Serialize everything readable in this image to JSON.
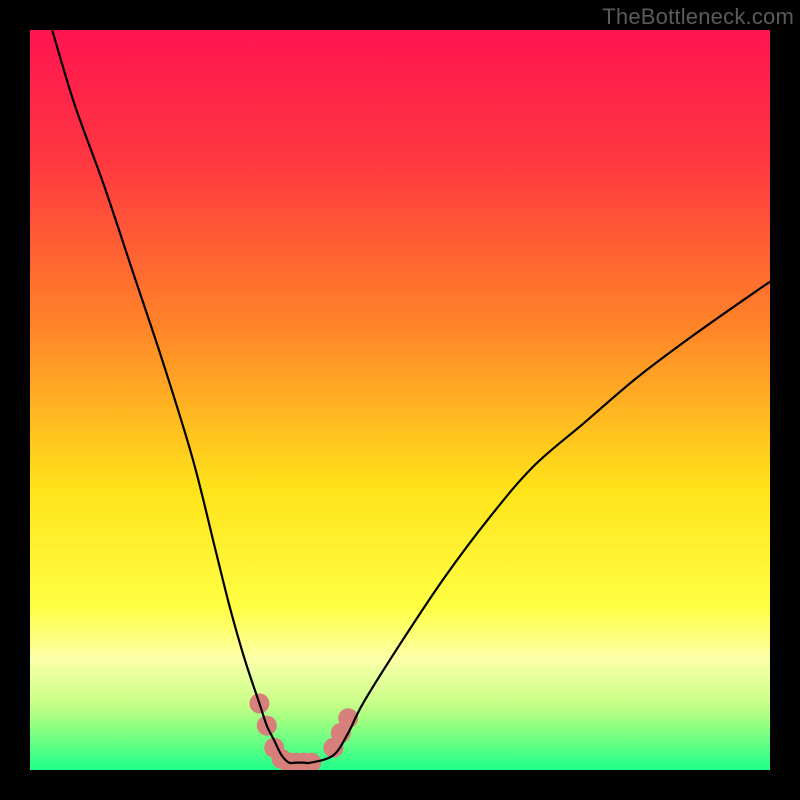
{
  "attribution": "TheBottleneck.com",
  "chart_data": {
    "type": "line",
    "title": "",
    "xlabel": "",
    "ylabel": "",
    "xlim": [
      0,
      100
    ],
    "ylim": [
      0,
      100
    ],
    "series": [
      {
        "name": "bottleneck-curve",
        "x": [
          3,
          6,
          10,
          14,
          18,
          22,
          25,
          27,
          29,
          31,
          32,
          33,
          34,
          35,
          36,
          37,
          38,
          41,
          43,
          45,
          50,
          56,
          62,
          68,
          75,
          82,
          90,
          100
        ],
        "y": [
          100,
          90,
          79,
          67,
          55,
          42,
          30,
          22,
          15,
          9,
          6,
          4,
          2,
          1,
          1,
          1,
          1,
          2,
          5,
          9,
          17,
          26,
          34,
          41,
          47,
          53,
          59,
          66
        ]
      }
    ],
    "markers": [
      {
        "x": 31,
        "y": 9
      },
      {
        "x": 32,
        "y": 6
      },
      {
        "x": 33,
        "y": 3
      },
      {
        "x": 34,
        "y": 1.5
      },
      {
        "x": 35,
        "y": 1
      },
      {
        "x": 36,
        "y": 1
      },
      {
        "x": 37,
        "y": 1
      },
      {
        "x": 38,
        "y": 1
      },
      {
        "x": 41,
        "y": 3
      },
      {
        "x": 42,
        "y": 5
      },
      {
        "x": 43,
        "y": 7
      }
    ],
    "gradient_stops": [
      {
        "offset": 0.0,
        "color": "#ff1450"
      },
      {
        "offset": 0.18,
        "color": "#ff3840"
      },
      {
        "offset": 0.4,
        "color": "#ff8428"
      },
      {
        "offset": 0.62,
        "color": "#ffe31a"
      },
      {
        "offset": 0.78,
        "color": "#ffff44"
      },
      {
        "offset": 0.85,
        "color": "#fbffa8"
      },
      {
        "offset": 0.91,
        "color": "#c8ff88"
      },
      {
        "offset": 0.94,
        "color": "#92ff80"
      },
      {
        "offset": 1.0,
        "color": "#1eff89"
      }
    ],
    "marker_style": {
      "fill": "#d77f7a",
      "radius": 10
    },
    "curve_style": {
      "stroke": "#000000",
      "width": 2.2
    }
  }
}
